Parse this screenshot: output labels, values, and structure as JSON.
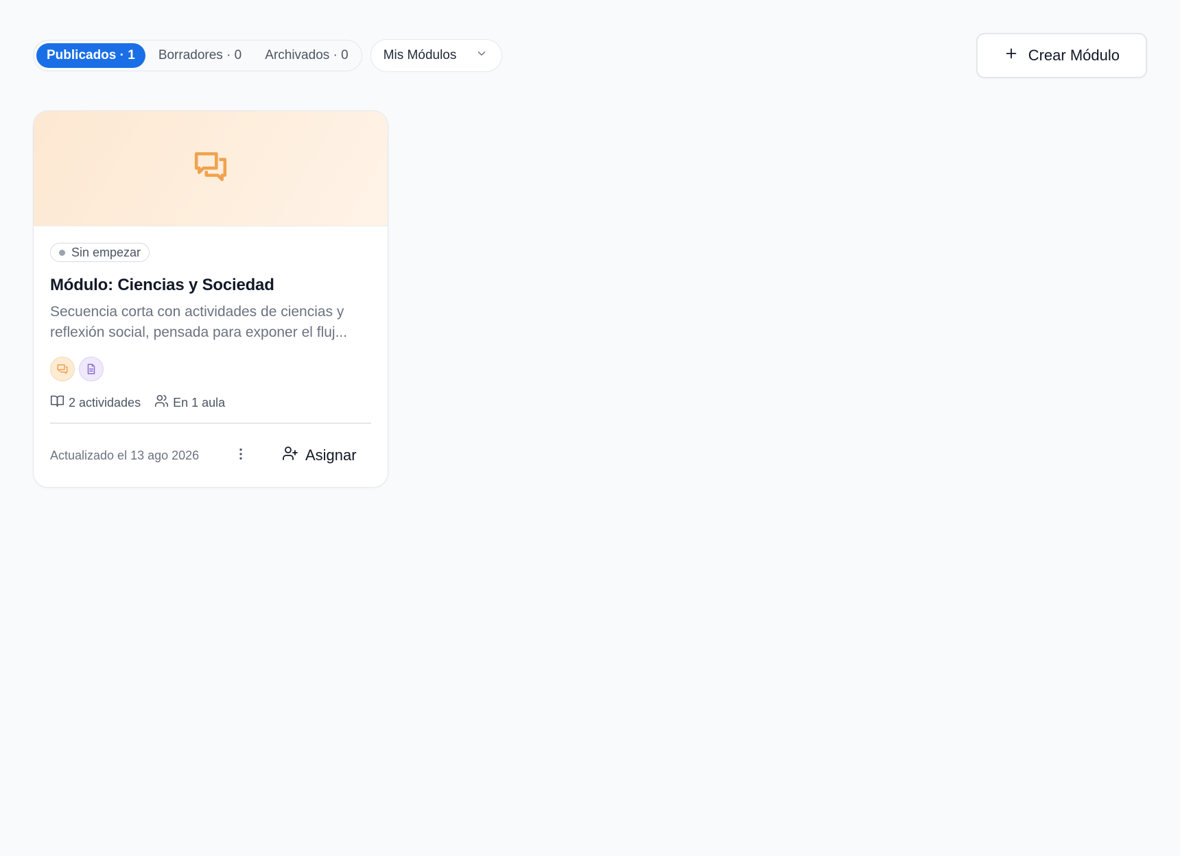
{
  "filters": {
    "tabs": [
      {
        "label": "Publicados · 1",
        "active": true
      },
      {
        "label": "Borradores · 0",
        "active": false
      },
      {
        "label": "Archivados · 0",
        "active": false
      }
    ],
    "scope_dropdown": {
      "selected": "Mis Módulos"
    }
  },
  "actions": {
    "create_label": "Crear Módulo"
  },
  "modules": [
    {
      "status": "Sin empezar",
      "title": "Módulo: Ciencias y Sociedad",
      "description": "Secuencia corta con actividades de ciencias y reflexión social, pensada para exponer el fluj...",
      "activity_types": [
        "discussion-icon",
        "document-icon"
      ],
      "activities": "2 actividades",
      "classrooms": "En 1 aula",
      "updated": "Actualizado el 13 ago 2026",
      "assign_label": "Asignar"
    }
  ],
  "colors": {
    "primary": "#1a6fe6",
    "accent_orange": "#f0a24e",
    "accent_purple": "#8b6cc9",
    "background": "#f9fafc"
  }
}
